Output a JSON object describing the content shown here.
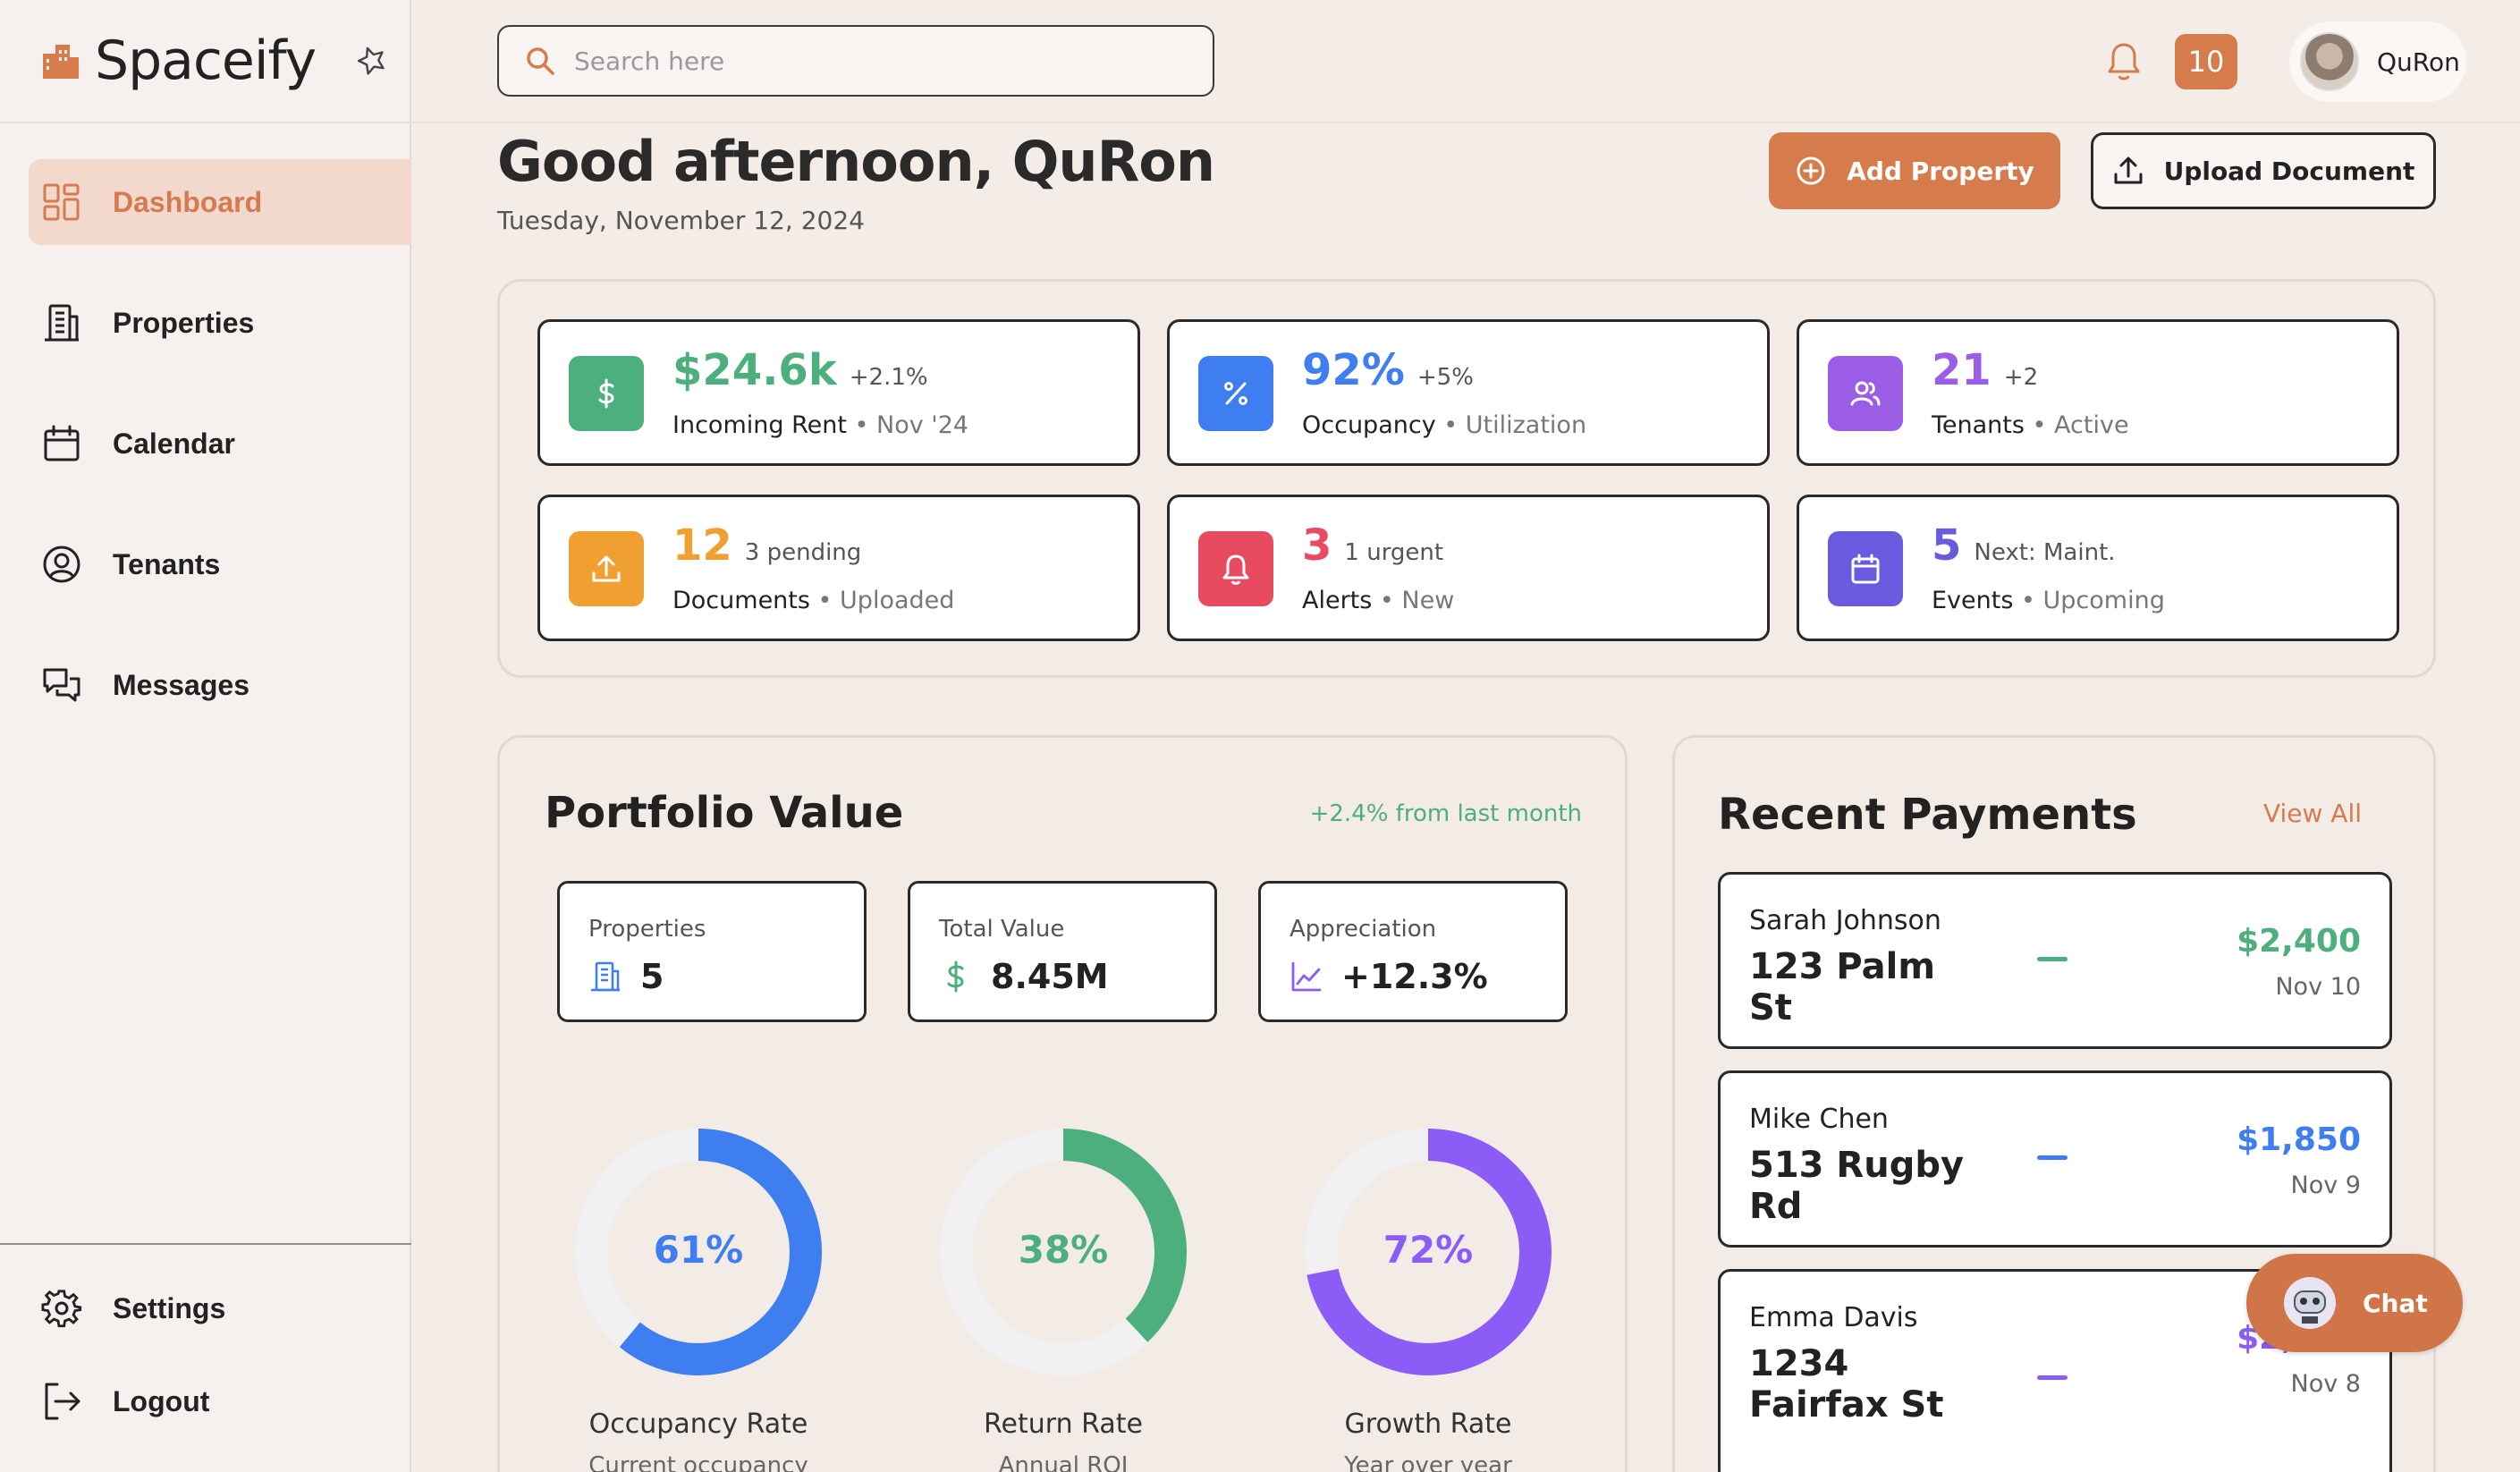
{
  "brand": {
    "name": "Spaceify"
  },
  "sidebar": {
    "items": [
      {
        "label": "Dashboard",
        "icon": "dashboard-icon",
        "active": true
      },
      {
        "label": "Properties",
        "icon": "building-icon"
      },
      {
        "label": "Calendar",
        "icon": "calendar-icon"
      },
      {
        "label": "Tenants",
        "icon": "user-circle-icon"
      },
      {
        "label": "Messages",
        "icon": "chat-bubbles-icon"
      }
    ],
    "bottom": [
      {
        "label": "Settings",
        "icon": "gear-icon"
      },
      {
        "label": "Logout",
        "icon": "logout-icon"
      }
    ]
  },
  "topbar": {
    "search_placeholder": "Search here",
    "notification_count": "10",
    "user_name": "QuRon"
  },
  "header": {
    "greeting": "Good afternoon, QuRon",
    "date": "Tuesday, November 12, 2024",
    "add_property": "Add Property",
    "upload_document": "Upload Document"
  },
  "stats": [
    {
      "value": "$24.6k",
      "delta": "+2.1%",
      "label": "Incoming Rent",
      "note": " • Nov '24",
      "color": "#4caf7d",
      "icon": "dollar-icon"
    },
    {
      "value": "92%",
      "delta": "+5%",
      "label": "Occupancy",
      "note": " • Utilization",
      "color": "#3f7ef0",
      "icon": "percent-icon"
    },
    {
      "value": "21",
      "delta": "+2",
      "label": "Tenants",
      "note": " • Active",
      "color": "#9b5de5",
      "icon": "users-icon"
    },
    {
      "value": "12",
      "delta": "3 pending",
      "label": "Documents",
      "note": " • Uploaded",
      "color": "#f0a030",
      "icon": "upload-icon"
    },
    {
      "value": "3",
      "delta": "1 urgent",
      "label": "Alerts",
      "note": " • New",
      "color": "#e84a5f",
      "icon": "bell-icon"
    },
    {
      "value": "5",
      "delta": "Next: Maint.",
      "label": "Events",
      "note": " • Upcoming",
      "color": "#6a5ae0",
      "icon": "calendar-icon"
    }
  ],
  "portfolio": {
    "title": "Portfolio Value",
    "change": "+2.4% from last month",
    "cards": [
      {
        "label": "Properties",
        "value": "5",
        "icon": "building-icon",
        "color": "#3f7ef0"
      },
      {
        "label": "Total Value",
        "value": "8.45M",
        "icon": "dollar-icon",
        "color": "#4caf7d"
      },
      {
        "label": "Appreciation",
        "value": "+12.3%",
        "icon": "trend-chart-icon",
        "color": "#8b5cf6"
      }
    ],
    "donuts": [
      {
        "label": "Occupancy Rate",
        "sub": "Current occupancy",
        "percent": 61,
        "text": "61%",
        "color": "#3f7ef0"
      },
      {
        "label": "Return Rate",
        "sub": "Annual ROI",
        "percent": 38,
        "text": "38%",
        "color": "#4caf7d"
      },
      {
        "label": "Growth Rate",
        "sub": "Year over year",
        "percent": 72,
        "text": "72%",
        "color": "#8b5cf6"
      }
    ]
  },
  "payments": {
    "title": "Recent Payments",
    "view_all": "View All",
    "items": [
      {
        "name": "Sarah Johnson",
        "address": "123 Palm St",
        "amount": "$2,400",
        "date": "Nov 10",
        "color": "#4caf7d"
      },
      {
        "name": "Mike Chen",
        "address": "513 Rugby Rd",
        "amount": "$1,850",
        "date": "Nov 9",
        "color": "#3f7ef0"
      },
      {
        "name": "Emma Davis",
        "address": "1234 Fairfax St",
        "amount": "$2,100",
        "date": "Nov 8",
        "color": "#8b5cf6"
      }
    ]
  },
  "chat": {
    "label": "Chat"
  }
}
